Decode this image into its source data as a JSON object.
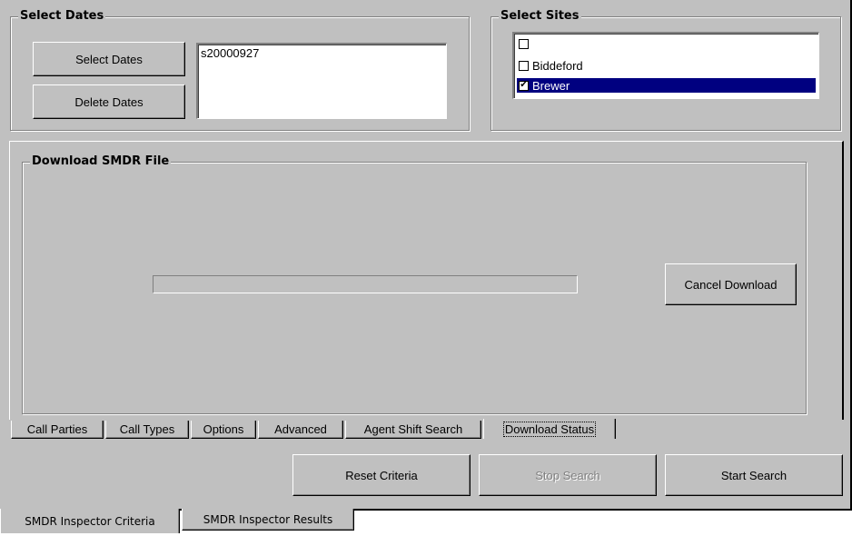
{
  "select_dates": {
    "title": "Select Dates",
    "select_button": "Select Dates",
    "delete_button": "Delete Dates",
    "dates": [
      "s20000927"
    ]
  },
  "select_sites": {
    "title": "Select Sites",
    "items": [
      {
        "label": "",
        "checked": false,
        "selected": false
      },
      {
        "label": "Biddeford",
        "checked": false,
        "selected": false
      },
      {
        "label": "Brewer",
        "checked": true,
        "selected": true
      }
    ]
  },
  "download": {
    "title": "Download SMDR File",
    "progress": 0,
    "cancel_button": "Cancel Download"
  },
  "inner_tabs": [
    {
      "label": "Call Parties",
      "active": false
    },
    {
      "label": "Call Types",
      "active": false
    },
    {
      "label": "Options",
      "active": false
    },
    {
      "label": "Advanced",
      "active": false
    },
    {
      "label": "Agent Shift Search",
      "active": false
    },
    {
      "label": "Download Status",
      "active": true
    }
  ],
  "actions": {
    "reset": "Reset Criteria",
    "stop": "Stop Search",
    "start": "Start Search"
  },
  "bottom_tabs": [
    {
      "label": "SMDR Inspector Criteria",
      "active": true
    },
    {
      "label": "SMDR Inspector Results",
      "active": false
    }
  ]
}
